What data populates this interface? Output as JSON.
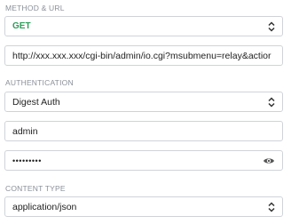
{
  "method_url": {
    "label": "METHOD & URL",
    "method": "GET",
    "url": "http://xxx.xxx.xxx/cgi-bin/admin/io.cgi?msubmenu=relay&actior"
  },
  "authentication": {
    "label": "AUTHENTICATION",
    "type": "Digest Auth",
    "username": "admin",
    "password_mask": "•••••••••"
  },
  "content_type": {
    "label": "CONTENT TYPE",
    "value": "application/json"
  },
  "icons": {
    "select": "chevron-up-down-icon",
    "visibility": "eye-icon"
  },
  "colors": {
    "method_text": "#2e9d5a",
    "border": "#cfd3d8",
    "label": "#8a8f98"
  }
}
